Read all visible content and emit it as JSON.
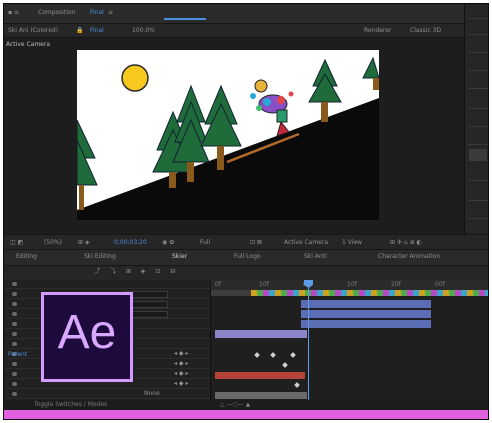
{
  "comp_tab": {
    "title": "Composition",
    "name": "Final"
  },
  "comp_toolbar": {
    "label": "Ski Ani (Colored)",
    "view": "Final",
    "value": "100.0%",
    "right_label": "Renderer",
    "right_value": "Classic 3D"
  },
  "viewer": {
    "camera_label": "Active Camera"
  },
  "viewer_footer": {
    "zoom": "(50%)",
    "timecode": "0;00;03;20",
    "resolution": "Full",
    "camera": "Active Camera",
    "views": "1 View"
  },
  "timeline_tabs": [
    {
      "label": "Editing"
    },
    {
      "label": "Ski Editing"
    },
    {
      "label": "Skier"
    },
    {
      "label": "Full Logo"
    },
    {
      "label": "Ski Anti"
    },
    {
      "label": "Character Animation"
    }
  ],
  "ruler": {
    "ticks": [
      "0f",
      "10f",
      "00f",
      "10f",
      "20f",
      "00f"
    ]
  },
  "status": {
    "left": "Toggle Switches / Modes"
  },
  "layers": {
    "parent_label": "None",
    "blue_label": "Parent"
  },
  "logo": {
    "text": "Ae"
  },
  "colors": {
    "accent": "#4a8fe0",
    "logo_border": "#d49bff",
    "logo_bg": "#1e0a3c",
    "band": "#e060e0",
    "track_blue": "#5a6db5",
    "track_red": "#b5433a",
    "track_purple": "#8b84c9"
  }
}
